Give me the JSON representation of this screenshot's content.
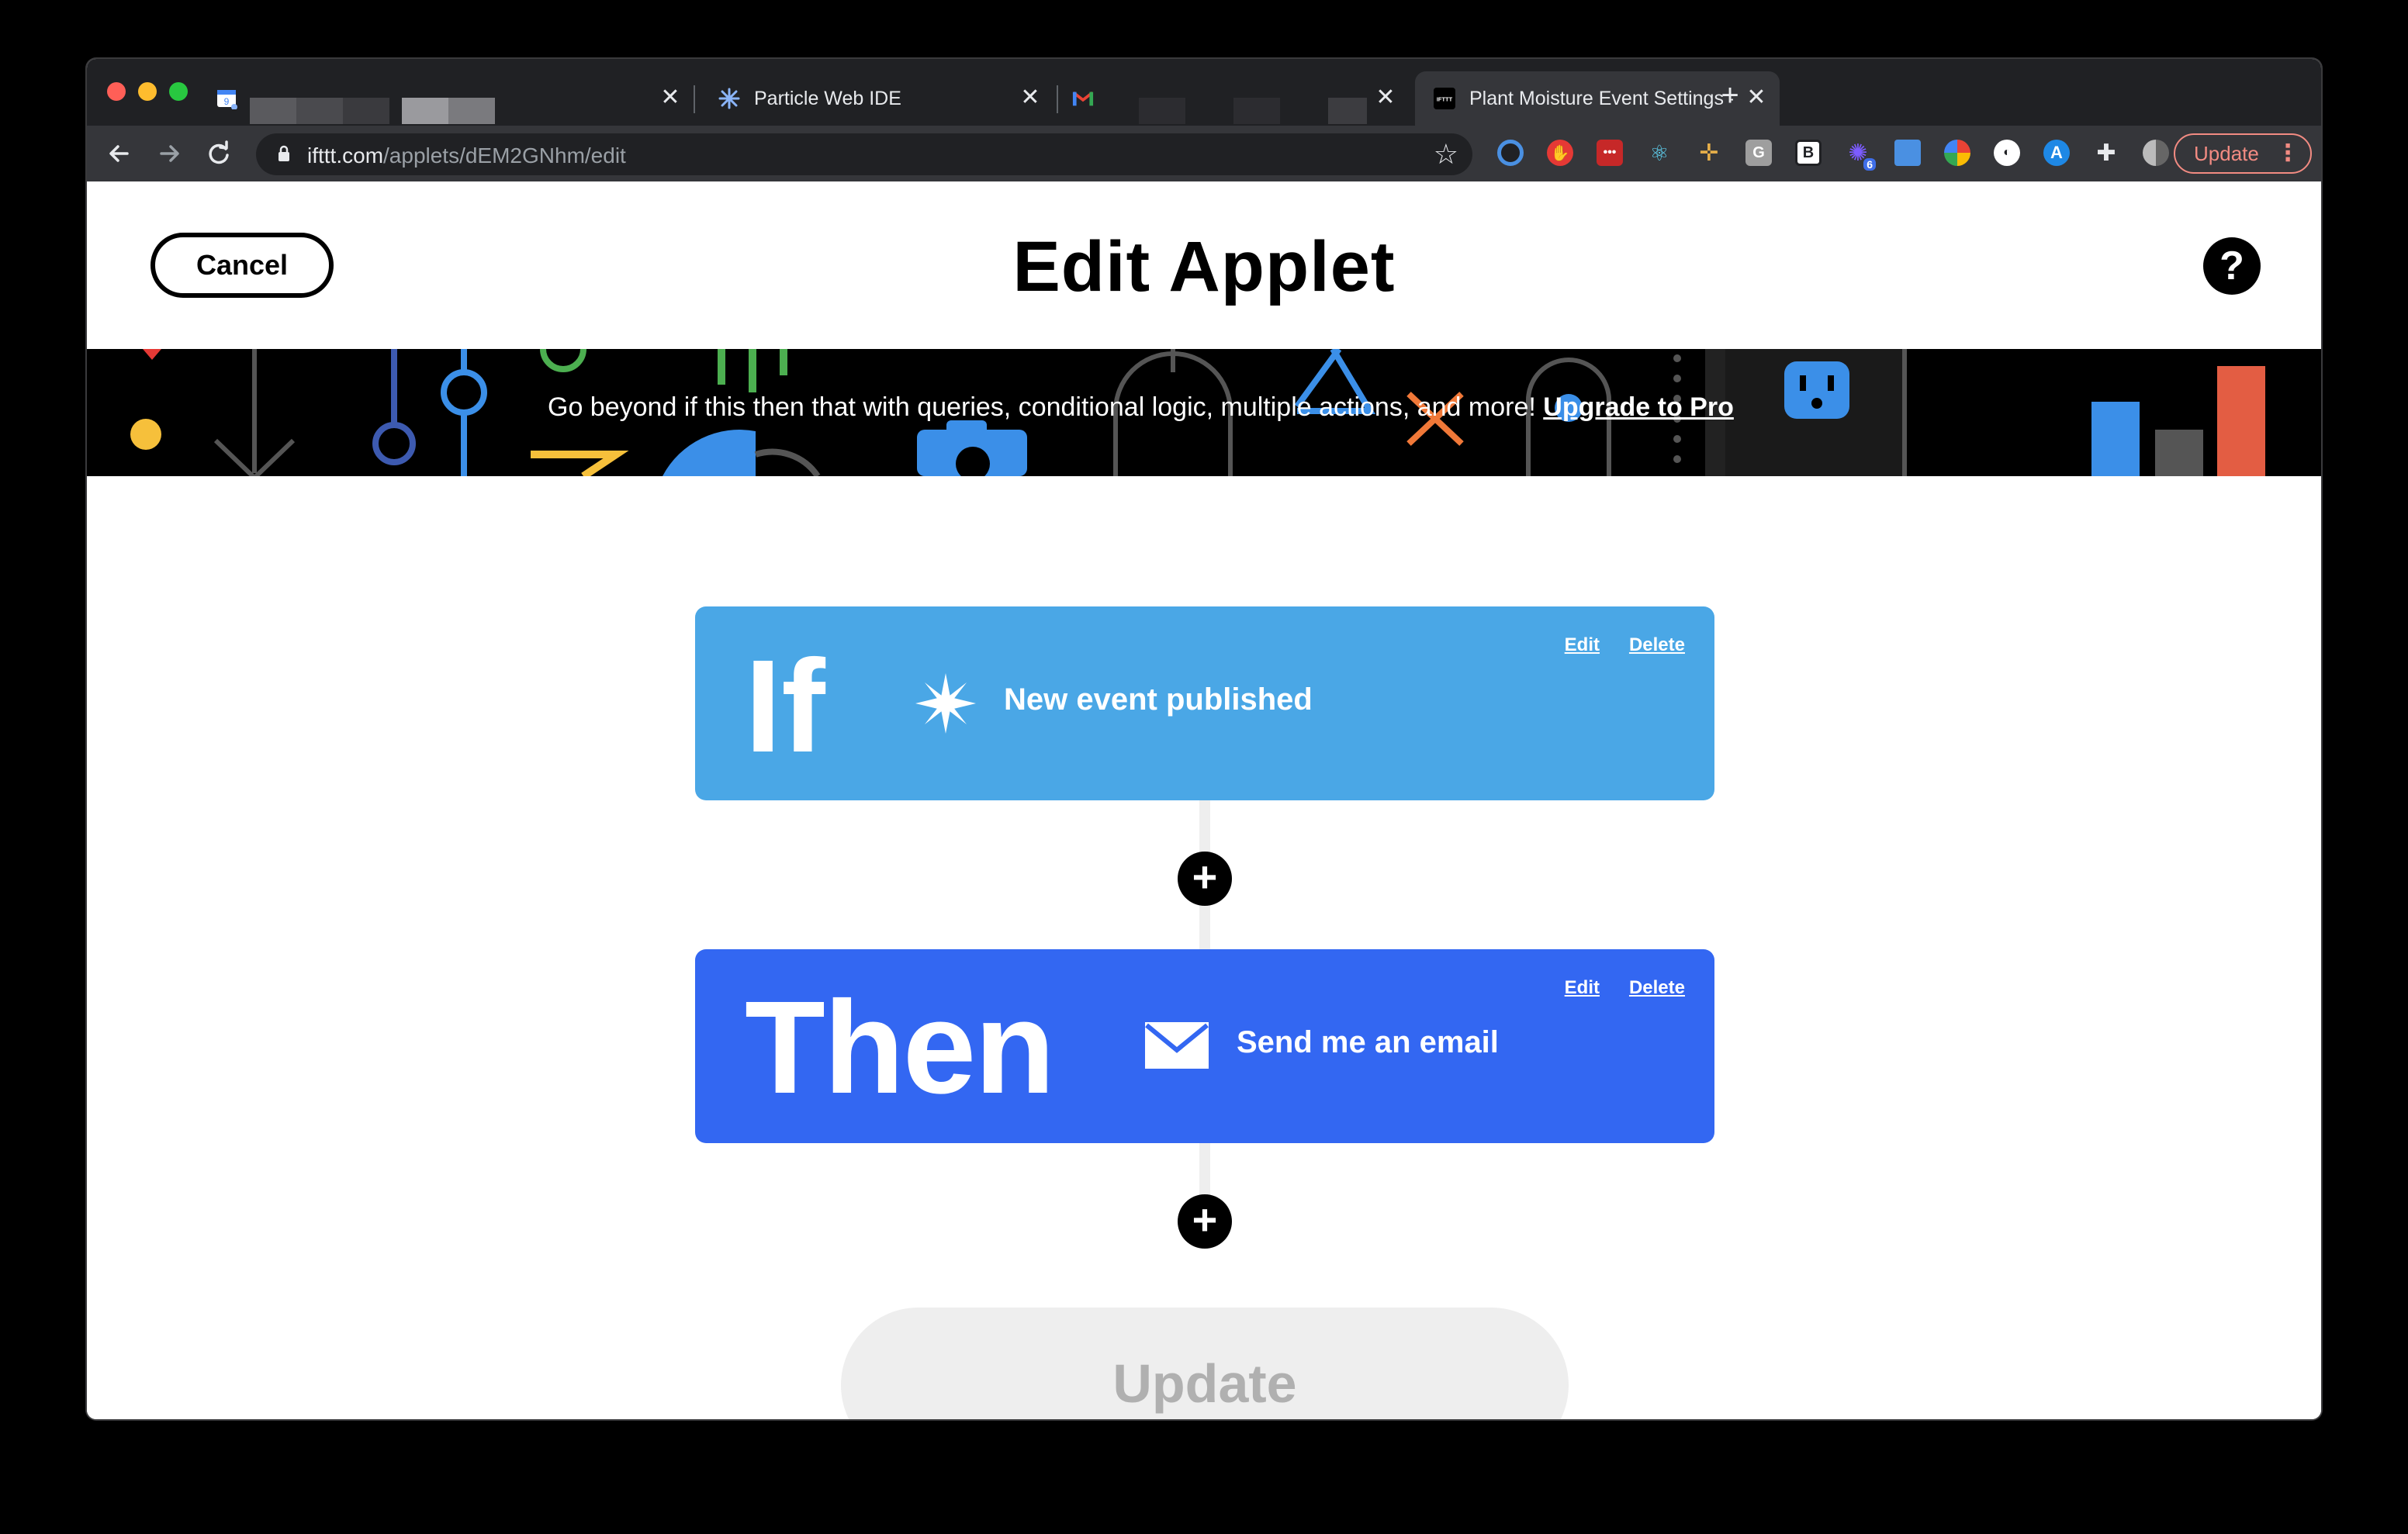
{
  "browser": {
    "tabs": [
      {
        "title": "",
        "favicon": "calendar-icon",
        "active": false
      },
      {
        "title": "Particle Web IDE",
        "favicon": "particle-star-icon",
        "active": false
      },
      {
        "title": "",
        "favicon": "gmail-icon",
        "active": false
      },
      {
        "title": "Plant Moisture Event Settings -",
        "favicon": "ifttt-icon",
        "active": true
      }
    ],
    "close_glyph": "✕",
    "new_tab_glyph": "+",
    "url_host": "ifttt.com",
    "url_path": "/applets/dEM2GNhm/edit",
    "update_label": "Update",
    "extension_badge": "6",
    "extension_letters": {
      "g": "G",
      "b": "B"
    }
  },
  "header": {
    "cancel_label": "Cancel",
    "title": "Edit Applet",
    "help_glyph": "?"
  },
  "banner": {
    "text": "Go beyond if this then that with queries, conditional logic, multiple actions, and more! ",
    "link": "Upgrade to Pro"
  },
  "trigger": {
    "keyword": "If",
    "service_icon": "particle-star-icon",
    "description": "New event published",
    "edit_label": "Edit",
    "delete_label": "Delete",
    "color": "#4aa7e6"
  },
  "action": {
    "keyword": "Then",
    "service_icon": "email-envelope-icon",
    "description": "Send me an email",
    "edit_label": "Edit",
    "delete_label": "Delete",
    "color": "#3367f2"
  },
  "add_glyph": "+",
  "footer": {
    "update_label": "Update"
  }
}
